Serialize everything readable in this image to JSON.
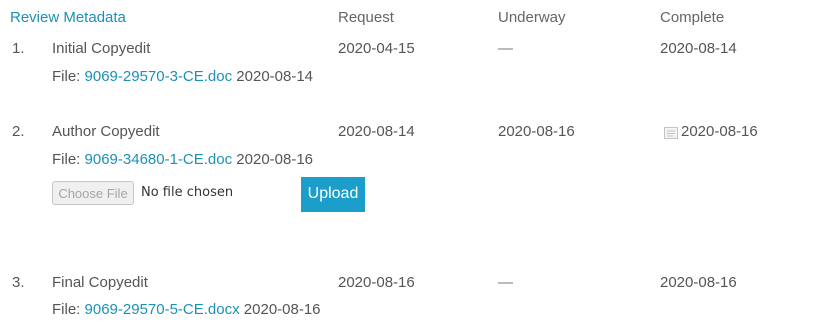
{
  "header": {
    "review_metadata": "Review Metadata",
    "request": "Request",
    "underway": "Underway",
    "complete": "Complete"
  },
  "rows": [
    {
      "number": "1.",
      "title": "Initial Copyedit",
      "file_label": "File:",
      "file_name": "9069-29570-3-CE.doc",
      "file_date": "2020-08-14",
      "request": "2020-04-15",
      "underway": "—",
      "complete": "2020-08-14"
    },
    {
      "number": "2.",
      "title": "Author Copyedit",
      "file_label": "File:",
      "file_name": "9069-34680-1-CE.doc",
      "file_date": "2020-08-16",
      "request": "2020-08-14",
      "underway": "2020-08-16",
      "complete": "2020-08-16",
      "complete_icon": "note-icon",
      "choose_file_label": "Choose File",
      "file_status": "No file chosen",
      "upload_label": "Upload"
    },
    {
      "number": "3.",
      "title": "Final Copyedit",
      "file_label": "File:",
      "file_name": "9069-29570-5-CE.docx",
      "file_date": "2020-08-16",
      "request": "2020-08-16",
      "underway": "—",
      "complete": "2020-08-16"
    }
  ],
  "colors": {
    "link": "#1a91b5",
    "upload_button": "#1b9ec9",
    "text": "#555555"
  }
}
